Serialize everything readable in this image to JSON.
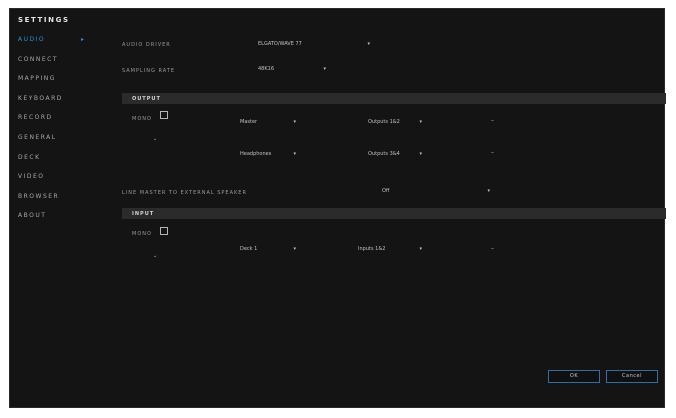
{
  "window": {
    "title": "SETTINGS"
  },
  "sidebar": {
    "items": [
      {
        "label": "AUDIO"
      },
      {
        "label": "CONNECT"
      },
      {
        "label": "MAPPING"
      },
      {
        "label": "KEYBOARD"
      },
      {
        "label": "RECORD"
      },
      {
        "label": "GENERAL"
      },
      {
        "label": "DECK"
      },
      {
        "label": "VIDEO"
      },
      {
        "label": "BROWSER"
      },
      {
        "label": "ABOUT"
      }
    ],
    "active_arrow": "▸"
  },
  "audio": {
    "driver_label": "AUDIO DRIVER",
    "driver_value": "ELGATO/WAVE 77",
    "sample_rate_label": "SAMPLING RATE",
    "sample_rate_value": "48K16",
    "output_header": "OUTPUT",
    "output": {
      "mono_label": "MONO",
      "rows": [
        {
          "device": "Master",
          "channel": "Outputs 1&2"
        },
        {
          "device": "Headphones",
          "channel": "Outputs 3&4"
        }
      ]
    },
    "line_master_label": "LINE MASTER TO EXTERNAL SPEAKER",
    "line_master_value": "Off",
    "input_header": "INPUT",
    "input": {
      "mono_label": "MONO",
      "rows": [
        {
          "device": "Deck 1",
          "channel": "Inputs 1&2"
        }
      ]
    }
  },
  "buttons": {
    "ok": "OK",
    "cancel": "Cancel"
  },
  "colors": {
    "accent": "#2d8fd8",
    "background": "#141414",
    "section": "#2b2b2b"
  },
  "glyphs": {
    "dropdown": "▾",
    "chevron": "⌄",
    "dash": "–"
  }
}
